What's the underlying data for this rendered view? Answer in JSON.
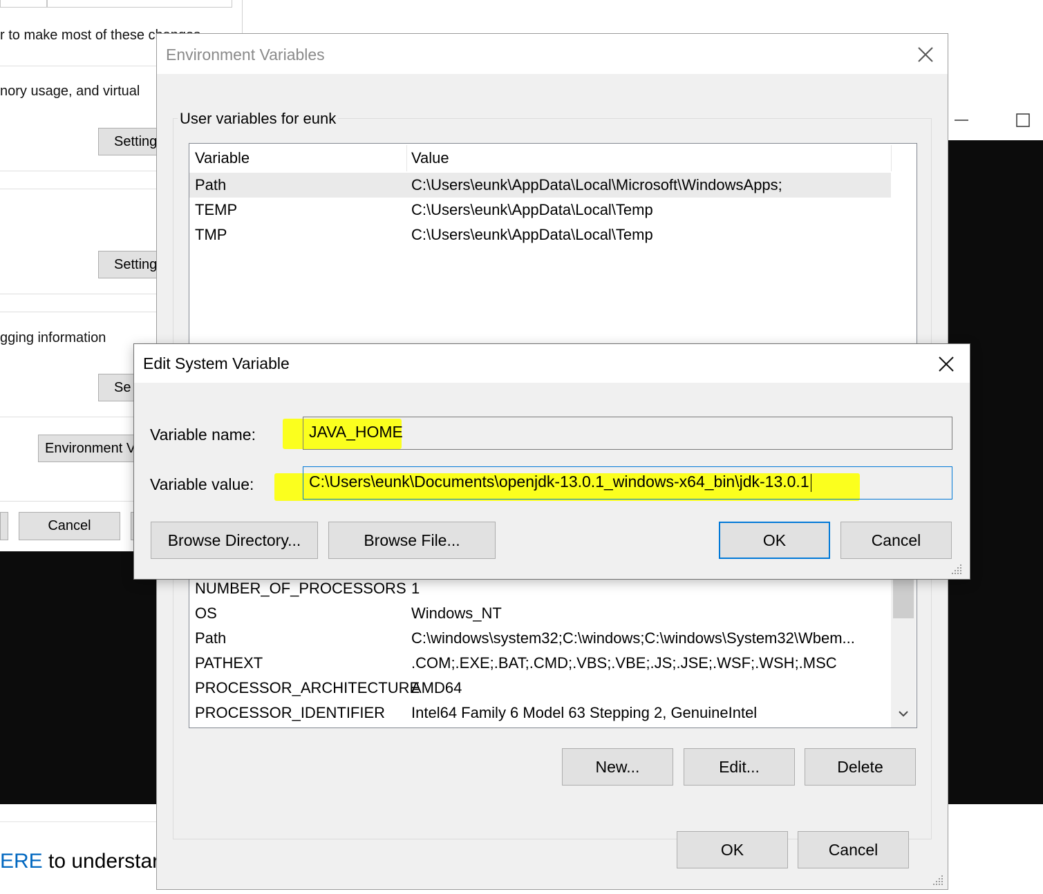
{
  "background": {
    "tab_label": "",
    "text_lines": [
      "r to make most of these changes",
      "nory usage, and virtual",
      "gging information"
    ],
    "settings_button_1": "Setting",
    "settings_button_2": "Setting",
    "settings_button_3": "Se",
    "env_vars_button": "Environment V",
    "cancel_button": "Cancel",
    "bottom_link": "ERE",
    "bottom_text": " to understar"
  },
  "env_window": {
    "title": "Environment Variables",
    "user_group_label": "User variables for eunk",
    "columns": {
      "variable": "Variable",
      "value": "Value"
    },
    "user_vars": [
      {
        "name": "Path",
        "value": "C:\\Users\\eunk\\AppData\\Local\\Microsoft\\WindowsApps;",
        "selected": true
      },
      {
        "name": "TEMP",
        "value": "C:\\Users\\eunk\\AppData\\Local\\Temp",
        "selected": false
      },
      {
        "name": "TMP",
        "value": "C:\\Users\\eunk\\AppData\\Local\\Temp",
        "selected": false
      }
    ],
    "system_vars": [
      {
        "name": "NUMBER_OF_PROCESSORS",
        "value": "1"
      },
      {
        "name": "OS",
        "value": "Windows_NT"
      },
      {
        "name": "Path",
        "value": "C:\\windows\\system32;C:\\windows;C:\\windows\\System32\\Wbem..."
      },
      {
        "name": "PATHEXT",
        "value": ".COM;.EXE;.BAT;.CMD;.VBS;.VBE;.JS;.JSE;.WSF;.WSH;.MSC"
      },
      {
        "name": "PROCESSOR_ARCHITECTURE",
        "value": "AMD64"
      },
      {
        "name": "PROCESSOR_IDENTIFIER",
        "value": "Intel64 Family 6 Model 63 Stepping 2, GenuineIntel"
      }
    ],
    "buttons": {
      "new": "New...",
      "edit": "Edit...",
      "delete": "Delete",
      "ok": "OK",
      "cancel": "Cancel"
    }
  },
  "edit_dialog": {
    "title": "Edit System Variable",
    "name_label": "Variable name:",
    "name_value": "JAVA_HOME",
    "value_label": "Variable value:",
    "value_value": "C:\\Users\\eunk\\Documents\\openjdk-13.0.1_windows-x64_bin\\jdk-13.0.1",
    "buttons": {
      "browse_directory": "Browse Directory...",
      "browse_file": "Browse File...",
      "ok": "OK",
      "cancel": "Cancel"
    }
  },
  "colors": {
    "highlight": "#fbff1e",
    "accent": "#0078d7",
    "link": "#0067c0",
    "console": "#0c0c0c"
  },
  "icons": [
    "close-icon",
    "maximize-icon",
    "minimize-icon",
    "chevron-down-icon",
    "resize-grip-icon"
  ]
}
